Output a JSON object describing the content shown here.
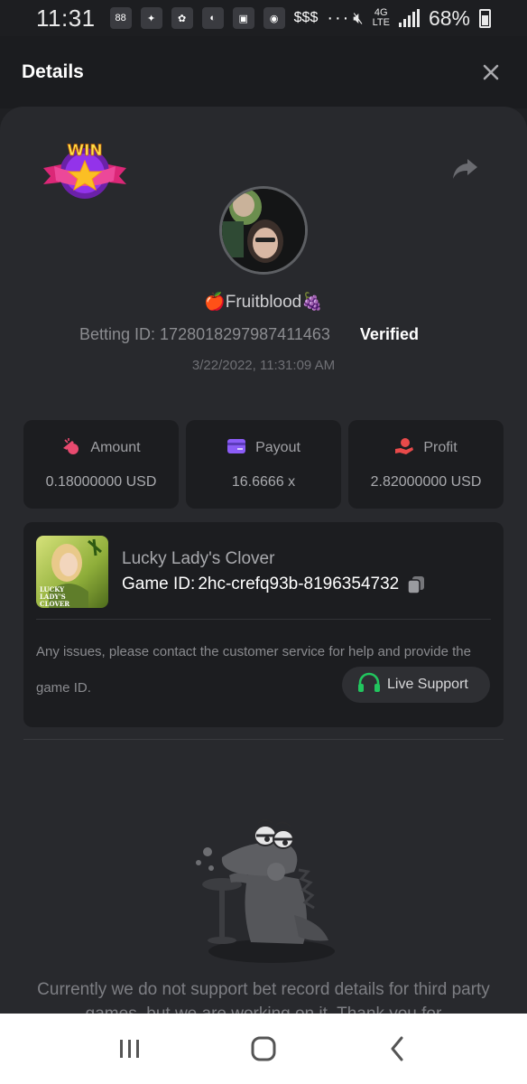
{
  "status_bar": {
    "time": "11:31",
    "notif_text": "$$$",
    "dots": "···",
    "battery": "68%"
  },
  "header": {
    "title": "Details",
    "close_icon": "close-icon"
  },
  "record": {
    "username": "🍎Fruitblood🍇",
    "betting_id": "Betting ID: 1728018297987411463",
    "verified": "Verified",
    "datetime": "3/22/2022, 11:31:09 AM"
  },
  "badge": {
    "text": "WIN"
  },
  "stats": [
    {
      "label": "Amount",
      "value": "0.18000000 USD",
      "icon": "amount-icon"
    },
    {
      "label": "Payout",
      "value": "16.6666 x",
      "icon": "payout-icon"
    },
    {
      "label": "Profit",
      "value": "2.82000000 USD",
      "icon": "profit-icon"
    }
  ],
  "game": {
    "name": "Lucky Lady's Clover",
    "id_label": "Game ID:",
    "id_value": "2hc-crefq93b-8196354732",
    "thumb_title": "LUCKY LADY'S CLOVER",
    "issues_text": "Any issues, please contact the customer service for help and provide the game ID.",
    "support_label": "Live Support"
  },
  "empty": {
    "message": "Currently we do not support bet record details for third party games, but we are working on it. Thank you for"
  },
  "colors": {
    "background": "#1f2023",
    "sheet": "#28292d",
    "card": "#1c1d20",
    "support_green": "#22c55e",
    "amount_pink": "#e84a6f",
    "payout_purple": "#8b5cf6",
    "profit_red": "#e84a4a"
  }
}
